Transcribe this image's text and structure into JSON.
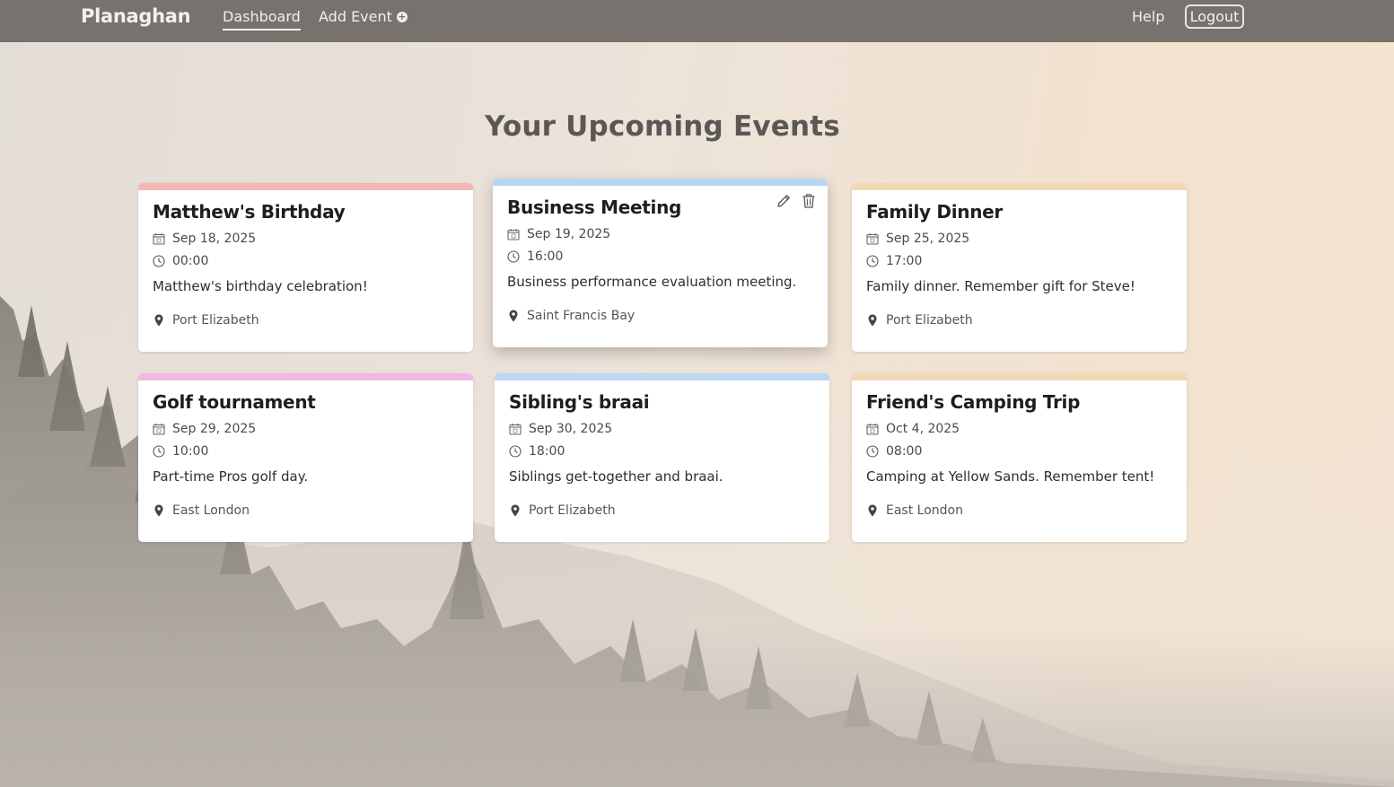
{
  "navbar": {
    "brand": "Planaghan",
    "links": {
      "dashboard": "Dashboard",
      "add_event": "Add Event",
      "help": "Help",
      "logout": "Logout"
    }
  },
  "main": {
    "title": "Your Upcoming Events",
    "events": [
      {
        "title": "Matthew's Birthday",
        "date": "Sep 18, 2025",
        "time": "00:00",
        "description": "Matthew's birthday celebration!",
        "location": "Port Elizabeth",
        "color": "#f4b7b3"
      },
      {
        "title": "Business Meeting",
        "date": "Sep 19, 2025",
        "time": "16:00",
        "description": "Business performance evaluation meeting.",
        "location": "Saint Francis Bay",
        "color": "#b9d5f2"
      },
      {
        "title": "Family Dinner",
        "date": "Sep 25, 2025",
        "time": "17:00",
        "description": "Family dinner. Remember gift for Steve!",
        "location": "Port Elizabeth",
        "color": "#f3d8b6"
      },
      {
        "title": "Golf tournament",
        "date": "Sep 29, 2025",
        "time": "10:00",
        "description": "Part-time Pros golf day.",
        "location": "East London",
        "color": "#f2b8e3"
      },
      {
        "title": "Sibling's braai",
        "date": "Sep 30, 2025",
        "time": "18:00",
        "description": "Siblings get-together and braai.",
        "location": "Port Elizabeth",
        "color": "#bcd8f4"
      },
      {
        "title": "Friend's Camping Trip",
        "date": "Oct 4, 2025",
        "time": "08:00",
        "description": "Camping at Yellow Sands. Remember tent!",
        "location": "East London",
        "color": "#f3d8b6"
      }
    ]
  },
  "icons": {
    "date": "calendar-icon",
    "time": "clock-icon",
    "location": "map-pin-icon",
    "edit": "pencil-icon",
    "delete": "trash-icon",
    "add": "plus-circle-icon"
  }
}
